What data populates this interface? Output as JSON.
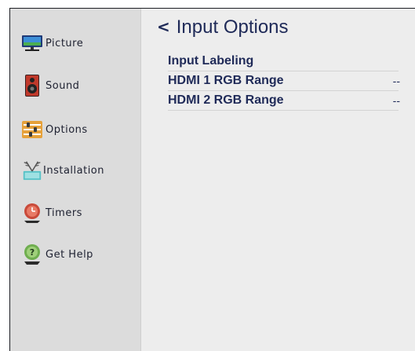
{
  "sidebar": {
    "items": [
      {
        "label": "Picture",
        "icon": "picture-icon"
      },
      {
        "label": "Sound",
        "icon": "speaker-icon"
      },
      {
        "label": "Options",
        "icon": "options-icon"
      },
      {
        "label": "Installation",
        "icon": "antenna-icon"
      },
      {
        "label": "Timers",
        "icon": "timer-icon"
      },
      {
        "label": "Get Help",
        "icon": "help-icon"
      }
    ]
  },
  "header": {
    "back_glyph": "<",
    "title": "Input Options"
  },
  "options": [
    {
      "label": "Input Labeling",
      "value": ""
    },
    {
      "label": "HDMI 1 RGB Range",
      "value": "--"
    },
    {
      "label": "HDMI 2 RGB Range",
      "value": "--"
    }
  ],
  "colors": {
    "accent_text": "#1f2a58",
    "sidebar_bg": "#dcdcdc",
    "main_bg": "#ededed"
  }
}
